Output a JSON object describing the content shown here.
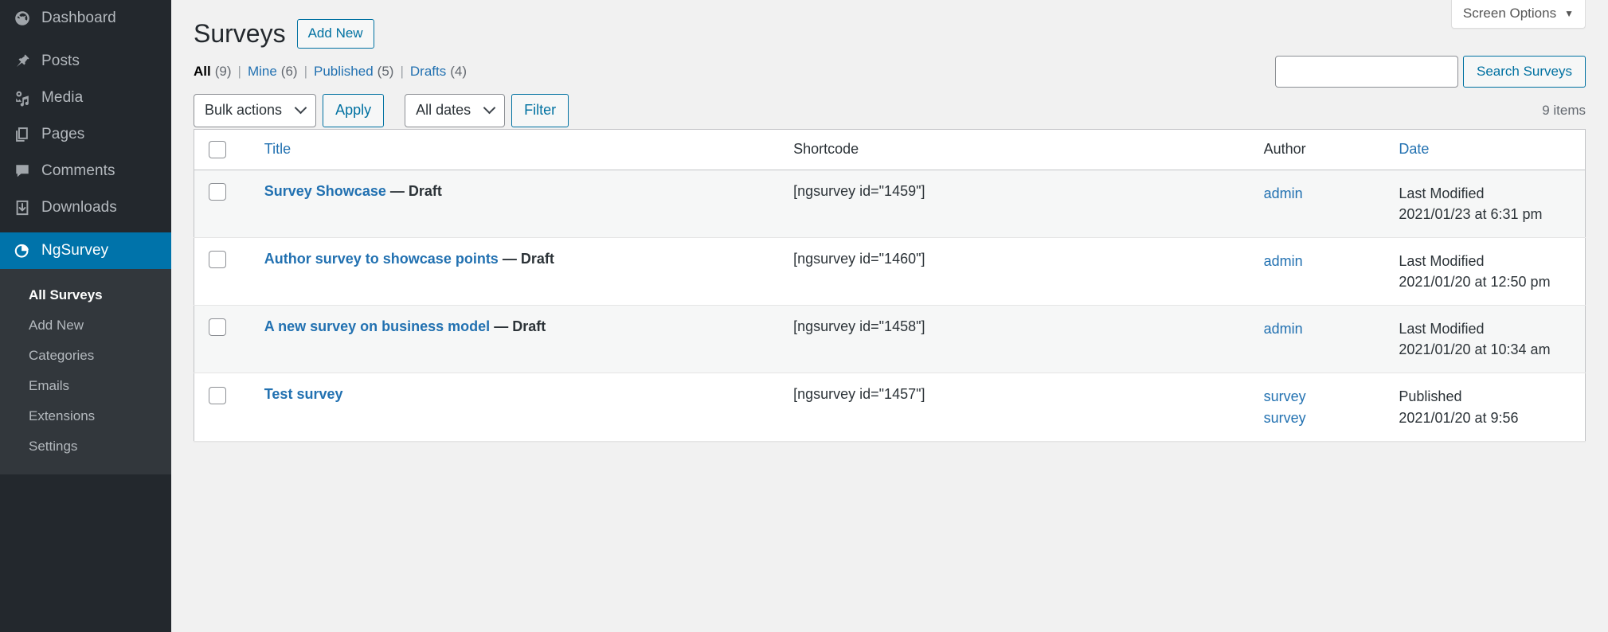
{
  "sidebar": {
    "items": [
      {
        "label": "Dashboard",
        "icon": "dashboard-icon",
        "current": false
      },
      {
        "label": "Posts",
        "icon": "pin-icon",
        "current": false
      },
      {
        "label": "Media",
        "icon": "media-icon",
        "current": false
      },
      {
        "label": "Pages",
        "icon": "pages-icon",
        "current": false
      },
      {
        "label": "Comments",
        "icon": "comments-icon",
        "current": false
      },
      {
        "label": "Downloads",
        "icon": "download-icon",
        "current": false
      },
      {
        "label": "NgSurvey",
        "icon": "chart-pie-icon",
        "current": true
      }
    ],
    "submenu": [
      {
        "label": "All Surveys",
        "current": true
      },
      {
        "label": "Add New",
        "current": false
      },
      {
        "label": "Categories",
        "current": false
      },
      {
        "label": "Emails",
        "current": false
      },
      {
        "label": "Extensions",
        "current": false
      },
      {
        "label": "Settings",
        "current": false
      }
    ],
    "active_color": "#0073aa"
  },
  "screen_options": {
    "label": "Screen Options",
    "caret": "▼"
  },
  "header": {
    "title": "Surveys",
    "add_new_label": "Add New"
  },
  "status_links": [
    {
      "label": "All",
      "count": "(9)",
      "current": true
    },
    {
      "label": "Mine",
      "count": "(6)",
      "current": false
    },
    {
      "label": "Published",
      "count": "(5)",
      "current": false
    },
    {
      "label": "Drafts",
      "count": "(4)",
      "current": false
    }
  ],
  "search": {
    "value": "",
    "placeholder": "",
    "button_label": "Search Surveys"
  },
  "tablenav": {
    "bulk_actions_label": "Bulk actions",
    "apply_label": "Apply",
    "dates_label": "All dates",
    "filter_label": "Filter",
    "displaying_num": "9 items"
  },
  "table": {
    "columns": [
      {
        "key": "cb",
        "label": "",
        "link": false
      },
      {
        "key": "title",
        "label": "Title",
        "link": true
      },
      {
        "key": "shortcode",
        "label": "Shortcode",
        "link": false
      },
      {
        "key": "author",
        "label": "Author",
        "link": false
      },
      {
        "key": "date",
        "label": "Date",
        "link": true
      }
    ],
    "rows": [
      {
        "title": "Survey Showcase",
        "state": "— Draft",
        "shortcode": "[ngsurvey id=\"1459\"]",
        "authors": [
          "admin"
        ],
        "date_status": "Last Modified",
        "date_value": "2021/01/23 at 6:31 pm"
      },
      {
        "title": "Author survey to showcase points",
        "state": "— Draft",
        "shortcode": "[ngsurvey id=\"1460\"]",
        "authors": [
          "admin"
        ],
        "date_status": "Last Modified",
        "date_value": "2021/01/20 at 12:50 pm"
      },
      {
        "title": "A new survey on business model",
        "state": "— Draft",
        "shortcode": "[ngsurvey id=\"1458\"]",
        "authors": [
          "admin"
        ],
        "date_status": "Last Modified",
        "date_value": "2021/01/20 at 10:34 am"
      },
      {
        "title": "Test survey",
        "state": "",
        "shortcode": "[ngsurvey id=\"1457\"]",
        "authors": [
          "survey",
          "survey"
        ],
        "date_status": "Published",
        "date_value": "2021/01/20 at 9:56"
      }
    ]
  }
}
